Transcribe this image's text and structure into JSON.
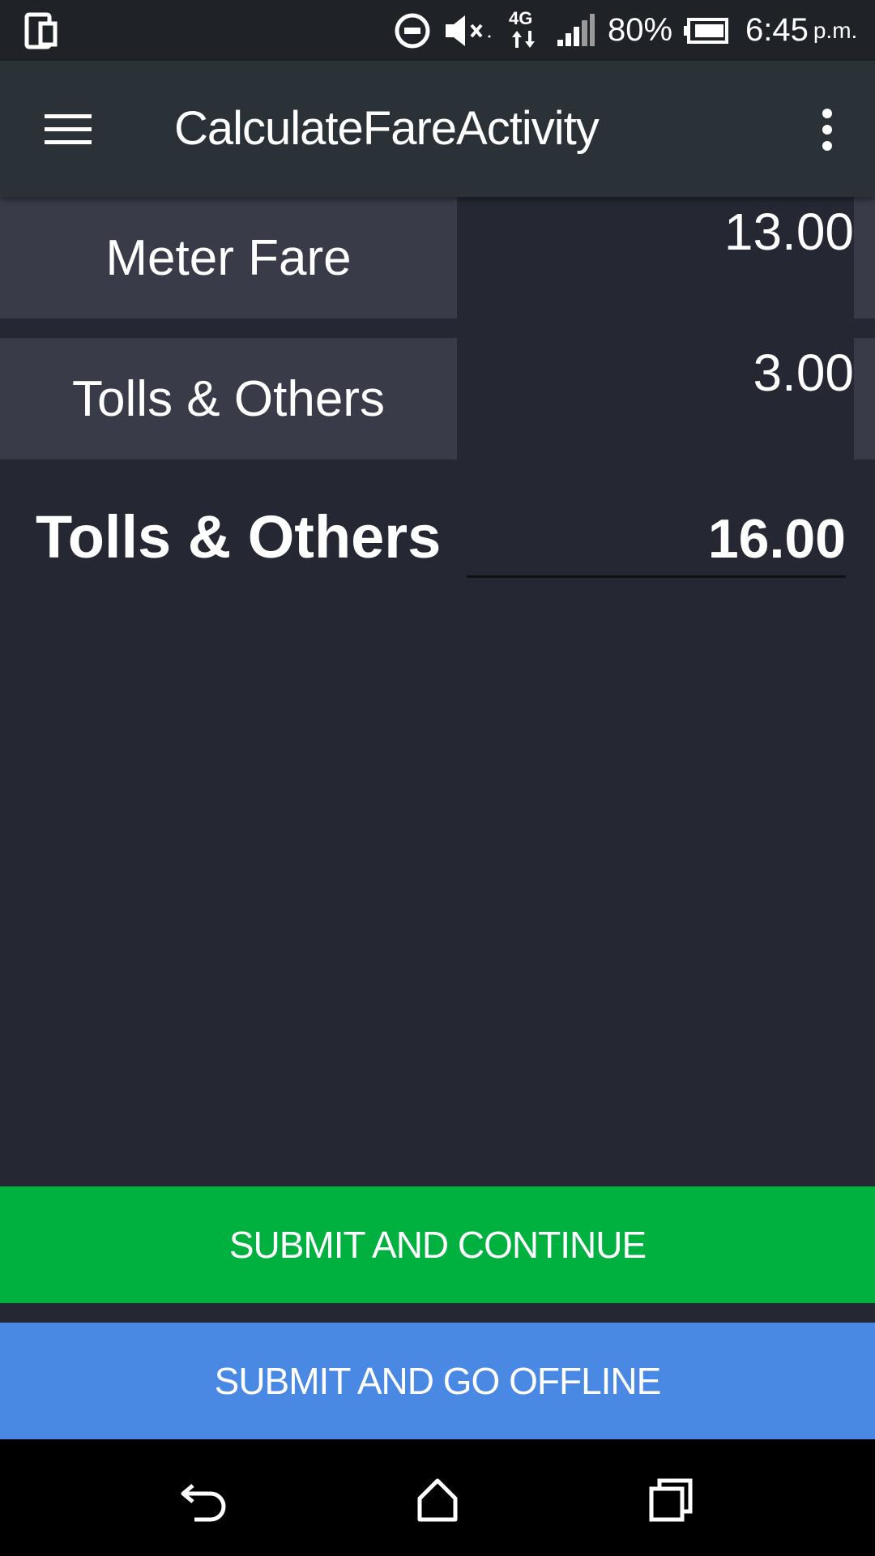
{
  "status_bar": {
    "battery_percent": "80%",
    "time": "6:45",
    "time_suffix": "p.m.",
    "network": "4G",
    "icons": [
      "device-icon",
      "do-not-disturb-icon",
      "mute-icon",
      "network-4g-icon",
      "signal-icon",
      "battery-icon"
    ]
  },
  "app_bar": {
    "title": "CalculateFareActivity",
    "icons": [
      "menu-icon",
      "more-options-icon"
    ]
  },
  "fare": {
    "meter_fare_label": "Meter Fare",
    "meter_fare_value": "13.00",
    "tolls_label": "Tolls & Others",
    "tolls_value": "3.00",
    "total_label": "Tolls & Others",
    "total_value": "16.00"
  },
  "buttons": {
    "submit_continue": "SUBMIT AND CONTINUE",
    "submit_offline": "SUBMIT AND GO OFFLINE"
  },
  "colors": {
    "background": "#252833",
    "cell_background": "#393b48",
    "app_bar": "#2a3237",
    "continue_button": "#00b140",
    "offline_button": "#4a89e3"
  },
  "nav_bar": {
    "icons": [
      "back-icon",
      "home-icon",
      "recents-icon"
    ]
  }
}
